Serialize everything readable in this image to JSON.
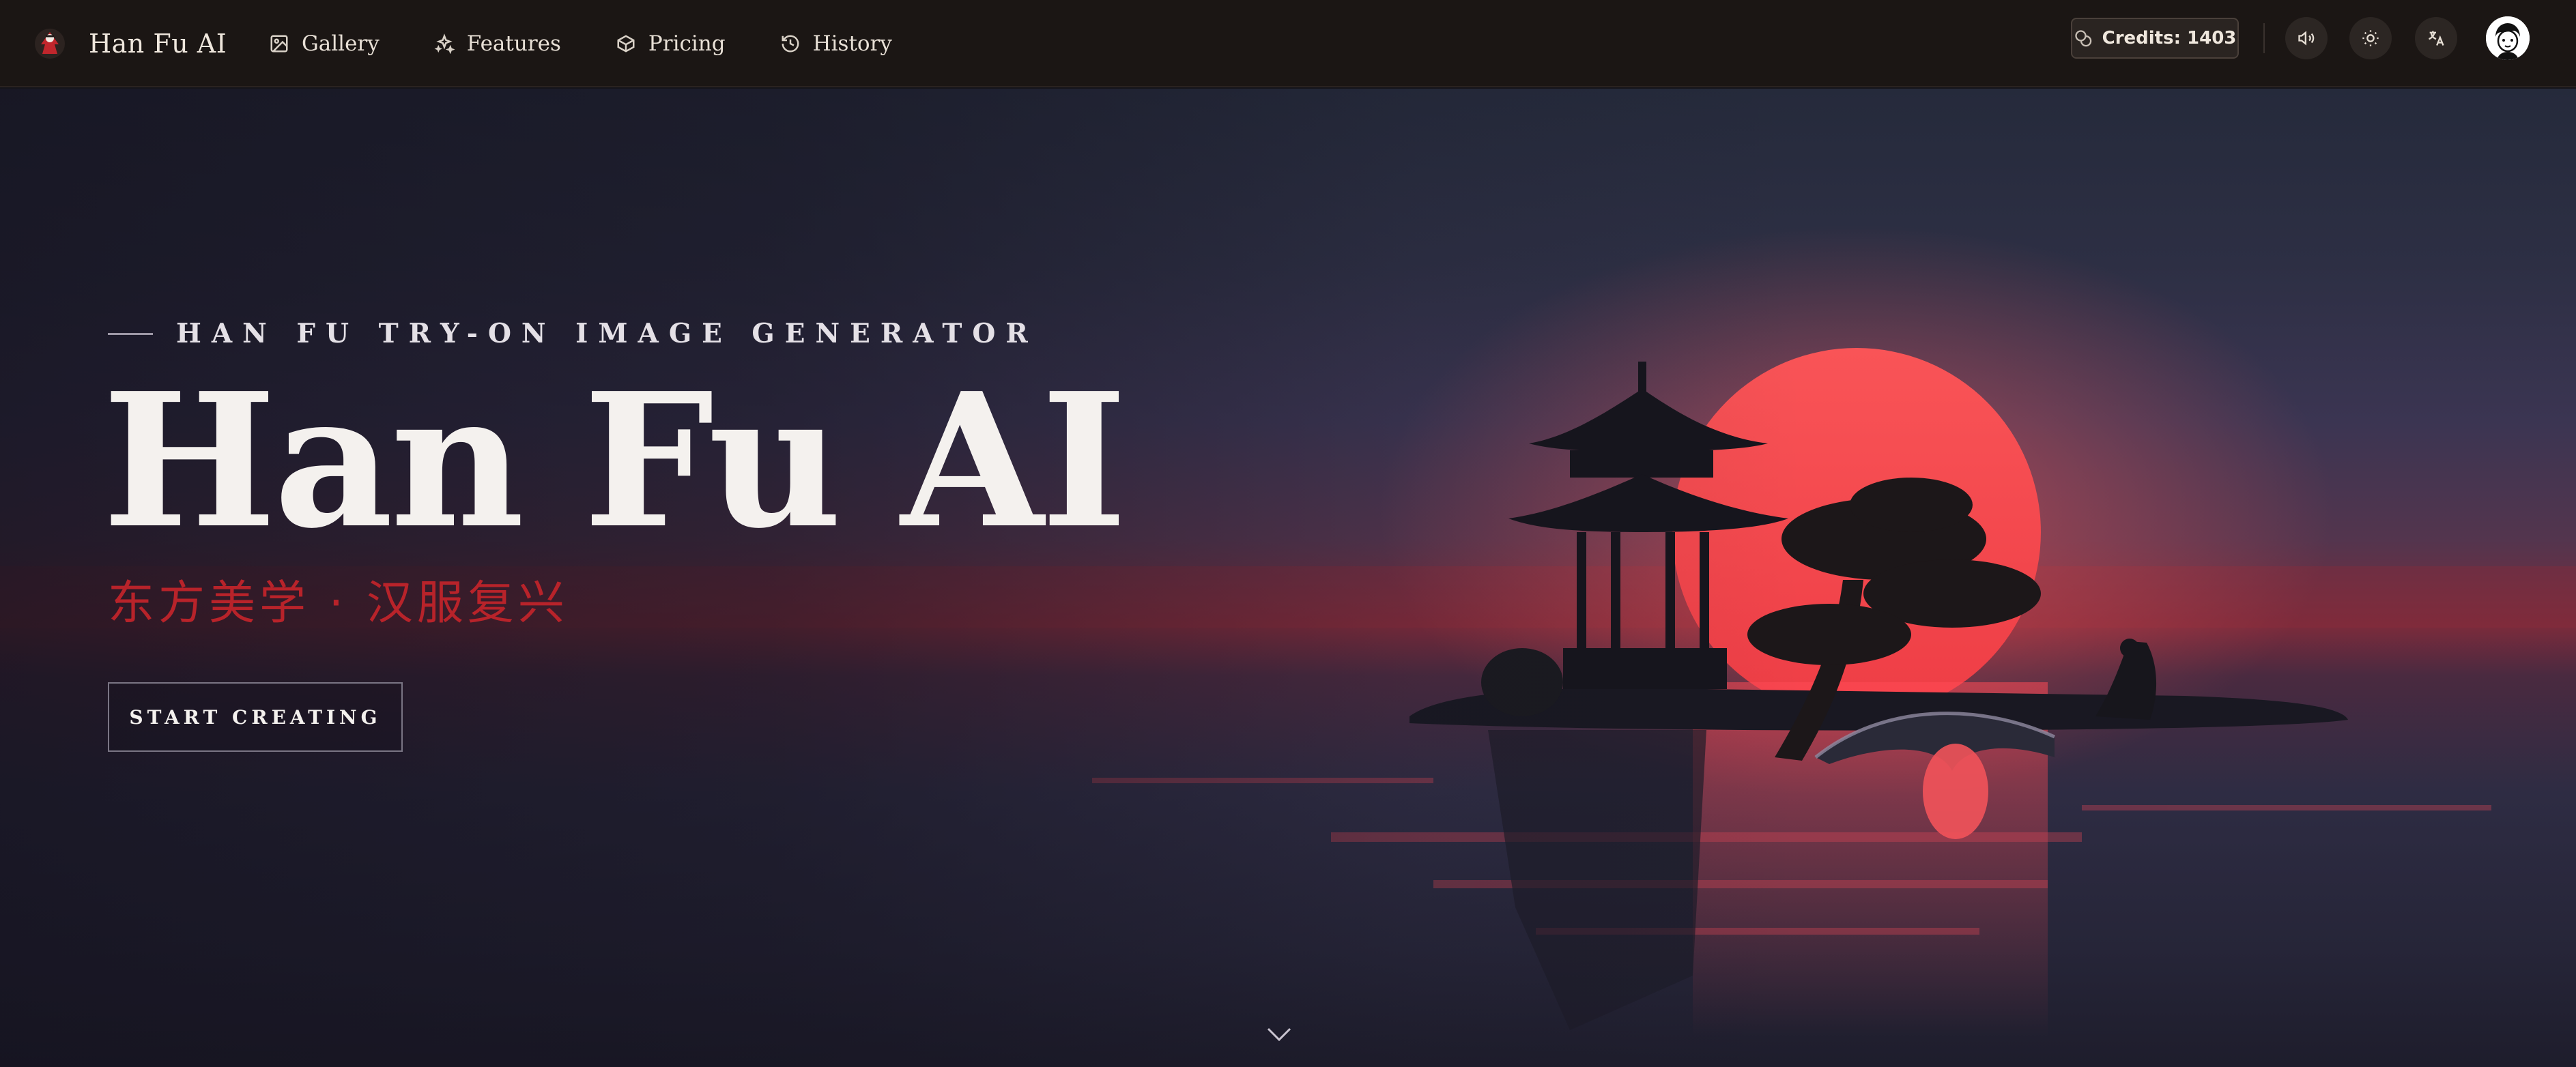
{
  "brand": {
    "name": "Han Fu AI",
    "logo_icon": "hanfu-logo-icon"
  },
  "nav": {
    "items": [
      {
        "label": "Gallery",
        "icon": "image-icon"
      },
      {
        "label": "Features",
        "icon": "sparkles-icon"
      },
      {
        "label": "Pricing",
        "icon": "box-icon"
      },
      {
        "label": "History",
        "icon": "history-icon"
      }
    ]
  },
  "header": {
    "credits_label": "Credits: 1403",
    "credits_icon": "coins-icon",
    "sound_icon": "speaker-icon",
    "theme_icon": "sun-icon",
    "language_icon": "translate-icon",
    "avatar_icon": "user-avatar-icon"
  },
  "hero": {
    "tagline": "HAN FU TRY-ON IMAGE GENERATOR",
    "title": "Han Fu AI",
    "subtitle": "东方美学 · 汉服复兴",
    "cta_label": "START CREATING",
    "scroll_icon": "chevron-down-icon"
  },
  "colors": {
    "navbar_bg": "#1b1614",
    "accent_red": "#b8232a",
    "sun": "#f0454a",
    "text_light": "#f4f1ee"
  }
}
